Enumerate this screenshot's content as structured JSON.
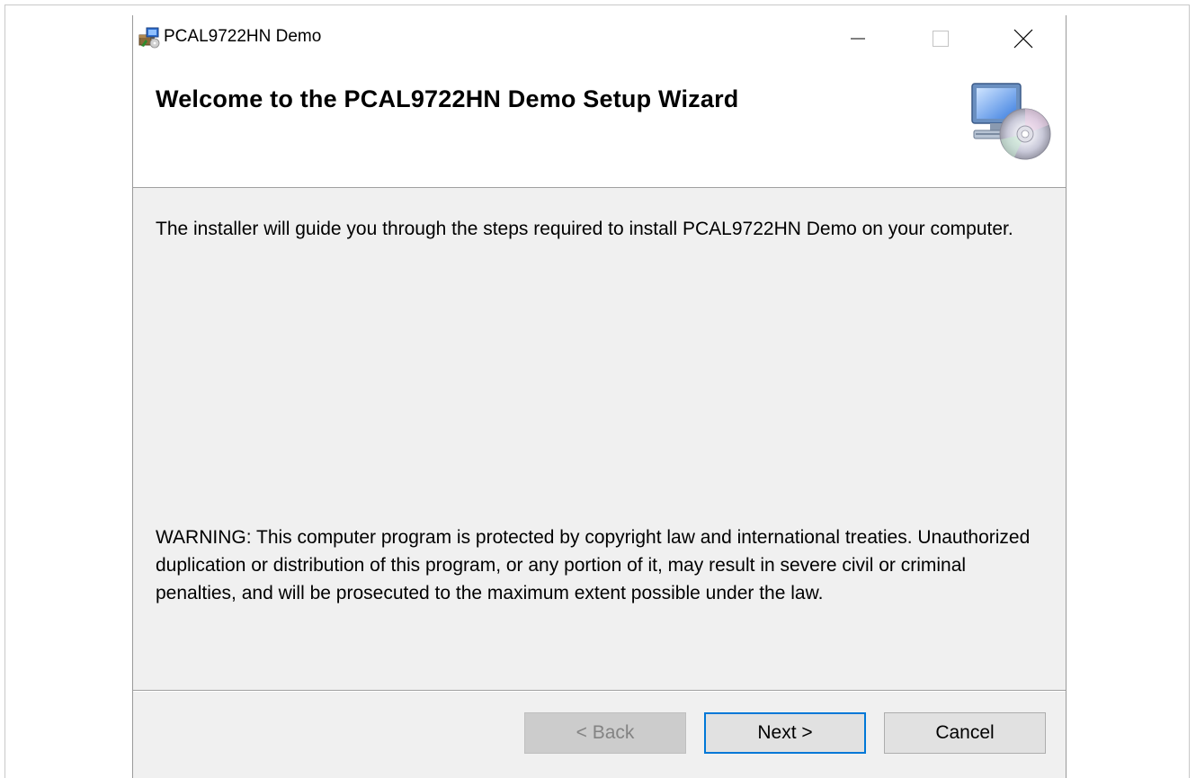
{
  "window": {
    "title": "PCAL9722HN Demo",
    "app_icon": "installer-package-icon",
    "controls": {
      "minimize": "minimize-icon",
      "maximize": "maximize-icon",
      "close": "close-icon"
    }
  },
  "banner": {
    "heading": "Welcome to the PCAL9722HN Demo Setup Wizard",
    "icon": "computer-cd-icon"
  },
  "body": {
    "intro": "The installer will guide you through the steps required to install PCAL9722HN Demo on your computer.",
    "warning": "WARNING: This computer program is protected by copyright law and international treaties. Unauthorized duplication or distribution of this program, or any portion of it, may result in severe civil or criminal penalties, and will be prosecuted to the maximum extent possible under the law."
  },
  "buttons": {
    "back": "< Back",
    "next": "Next >",
    "cancel": "Cancel"
  },
  "colors": {
    "accent": "#0078d7",
    "dialog_bg": "#f0f0f0",
    "banner_bg": "#ffffff",
    "disabled_text": "#838383"
  }
}
